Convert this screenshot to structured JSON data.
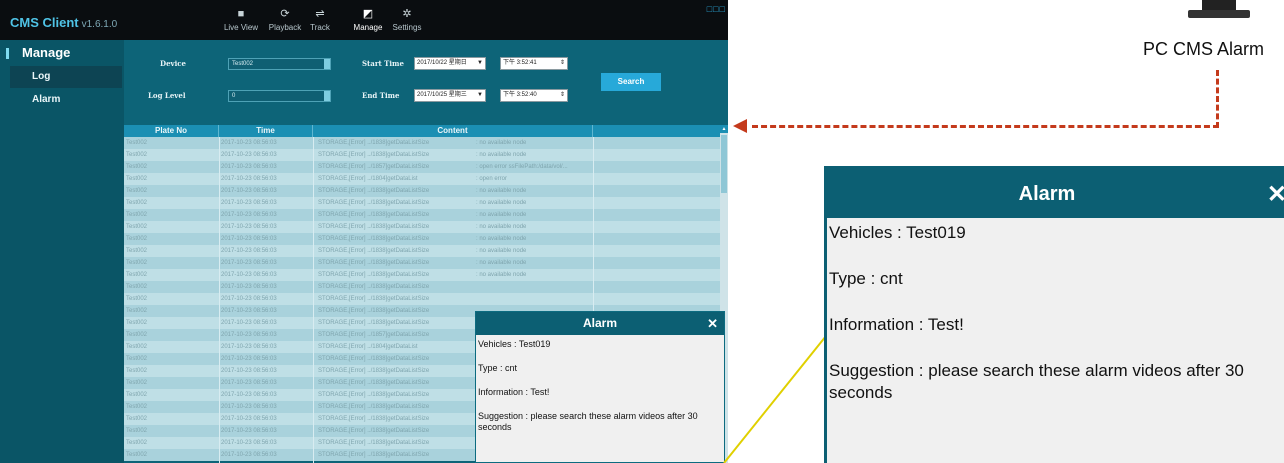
{
  "app": {
    "title": "CMS Client",
    "version": "v1.6.1.0",
    "window_controls": "□□□"
  },
  "nav": [
    {
      "label": "Live View",
      "icon": "camera-icon",
      "glyph": "■"
    },
    {
      "label": "Playback",
      "icon": "playback-icon",
      "glyph": "⟳"
    },
    {
      "label": "Track",
      "icon": "track-icon",
      "glyph": "⇌"
    },
    {
      "label": "Manage",
      "icon": "manage-icon",
      "glyph": "◩"
    },
    {
      "label": "Settings",
      "icon": "settings-icon",
      "glyph": "✲"
    }
  ],
  "sidebar": {
    "title": "Manage",
    "items": [
      {
        "label": "Log"
      },
      {
        "label": "Alarm"
      }
    ]
  },
  "filters": {
    "device_label": "Device",
    "device_value": "Test002",
    "log_level_label": "Log Level",
    "log_level_value": "0",
    "start_time_label": "Start Time",
    "start_date": "2017/10/22 星期日",
    "start_time": "下午 3:52:41",
    "end_time_label": "End Time",
    "end_date": "2017/10/25 星期三",
    "end_time": "下午 3:52:40",
    "search_label": "Search"
  },
  "table": {
    "columns": [
      "Plate No",
      "Time",
      "Content"
    ],
    "rows": [
      {
        "plate": "Test002",
        "time": "2017-10-23 08:56:03",
        "func": "STORAGE,[Error] ../1838]getDataListSize",
        "msg": ": no available node"
      },
      {
        "plate": "Test002",
        "time": "2017-10-23 08:56:03",
        "func": "STORAGE,[Error] ../1838]getDataListSize",
        "msg": ": no available node"
      },
      {
        "plate": "Test002",
        "time": "2017-10-23 08:56:03",
        "func": "STORAGE,[Error] ../1857]getDataListSize",
        "msg": ": open error ssFilePath:/data/vol/..."
      },
      {
        "plate": "Test002",
        "time": "2017-10-23 08:56:03",
        "func": "STORAGE,[Error] ../1804]getDataList",
        "msg": ": open error"
      },
      {
        "plate": "Test002",
        "time": "2017-10-23 08:56:03",
        "func": "STORAGE,[Error] ../1838]getDataListSize",
        "msg": ": no available node"
      },
      {
        "plate": "Test002",
        "time": "2017-10-23 08:56:03",
        "func": "STORAGE,[Error] ../1838]getDataListSize",
        "msg": ": no available node"
      },
      {
        "plate": "Test002",
        "time": "2017-10-23 08:56:03",
        "func": "STORAGE,[Error] ../1838]getDataListSize",
        "msg": ": no available node"
      },
      {
        "plate": "Test002",
        "time": "2017-10-23 08:56:03",
        "func": "STORAGE,[Error] ../1838]getDataListSize",
        "msg": ": no available node"
      },
      {
        "plate": "Test002",
        "time": "2017-10-23 08:56:03",
        "func": "STORAGE,[Error] ../1838]getDataListSize",
        "msg": ": no available node"
      },
      {
        "plate": "Test002",
        "time": "2017-10-23 08:56:03",
        "func": "STORAGE,[Error] ../1838]getDataListSize",
        "msg": ": no available node"
      },
      {
        "plate": "Test002",
        "time": "2017-10-23 08:56:03",
        "func": "STORAGE,[Error] ../1838]getDataListSize",
        "msg": ": no available node"
      },
      {
        "plate": "Test002",
        "time": "2017-10-23 08:56:03",
        "func": "STORAGE,[Error] ../1838]getDataListSize",
        "msg": ": no available node"
      },
      {
        "plate": "Test002",
        "time": "2017-10-23 08:56:03",
        "func": "STORAGE,[Error] ../1838]getDataListSize",
        "msg": ""
      },
      {
        "plate": "Test002",
        "time": "2017-10-23 08:56:03",
        "func": "STORAGE,[Error] ../1838]getDataListSize",
        "msg": ""
      },
      {
        "plate": "Test002",
        "time": "2017-10-23 08:56:03",
        "func": "STORAGE,[Error] ../1838]getDataListSize",
        "msg": ""
      },
      {
        "plate": "Test002",
        "time": "2017-10-23 08:56:03",
        "func": "STORAGE,[Error] ../1838]getDataListSize",
        "msg": ""
      },
      {
        "plate": "Test002",
        "time": "2017-10-23 08:56:03",
        "func": "STORAGE,[Error] ../1857]getDataListSize",
        "msg": ""
      },
      {
        "plate": "Test002",
        "time": "2017-10-23 08:56:03",
        "func": "STORAGE,[Error] ../1804]getDataList",
        "msg": ""
      },
      {
        "plate": "Test002",
        "time": "2017-10-23 08:56:03",
        "func": "STORAGE,[Error] ../1838]getDataListSize",
        "msg": ""
      },
      {
        "plate": "Test002",
        "time": "2017-10-23 08:56:03",
        "func": "STORAGE,[Error] ../1838]getDataListSize",
        "msg": ""
      },
      {
        "plate": "Test002",
        "time": "2017-10-23 08:56:03",
        "func": "STORAGE,[Error] ../1838]getDataListSize",
        "msg": ""
      },
      {
        "plate": "Test002",
        "time": "2017-10-23 08:56:03",
        "func": "STORAGE,[Error] ../1838]getDataListSize",
        "msg": ""
      },
      {
        "plate": "Test002",
        "time": "2017-10-23 08:56:03",
        "func": "STORAGE,[Error] ../1838]getDataListSize",
        "msg": ""
      },
      {
        "plate": "Test002",
        "time": "2017-10-23 08:56:03",
        "func": "STORAGE,[Error] ../1838]getDataListSize",
        "msg": ""
      },
      {
        "plate": "Test002",
        "time": "2017-10-23 08:56:03",
        "func": "STORAGE,[Error] ../1838]getDataListSize",
        "msg": ""
      },
      {
        "plate": "Test002",
        "time": "2017-10-23 08:56:03",
        "func": "STORAGE,[Error] ../1838]getDataListSize",
        "msg": ""
      },
      {
        "plate": "Test002",
        "time": "2017-10-23 08:56:03",
        "func": "STORAGE,[Error] ../1838]getDataListSize",
        "msg": ""
      }
    ]
  },
  "alarm_popup": {
    "title": "Alarm",
    "close": "✕",
    "vehicles": "Vehicles : Test019",
    "type": "Type : cnt",
    "information": "Information : Test!",
    "suggestion": "Suggestion : please search these alarm videos after 30 seconds"
  },
  "annotation": {
    "label": "PC CMS Alarm",
    "arrow_color": "#c43a1c",
    "connector_color": "#e0d000"
  }
}
